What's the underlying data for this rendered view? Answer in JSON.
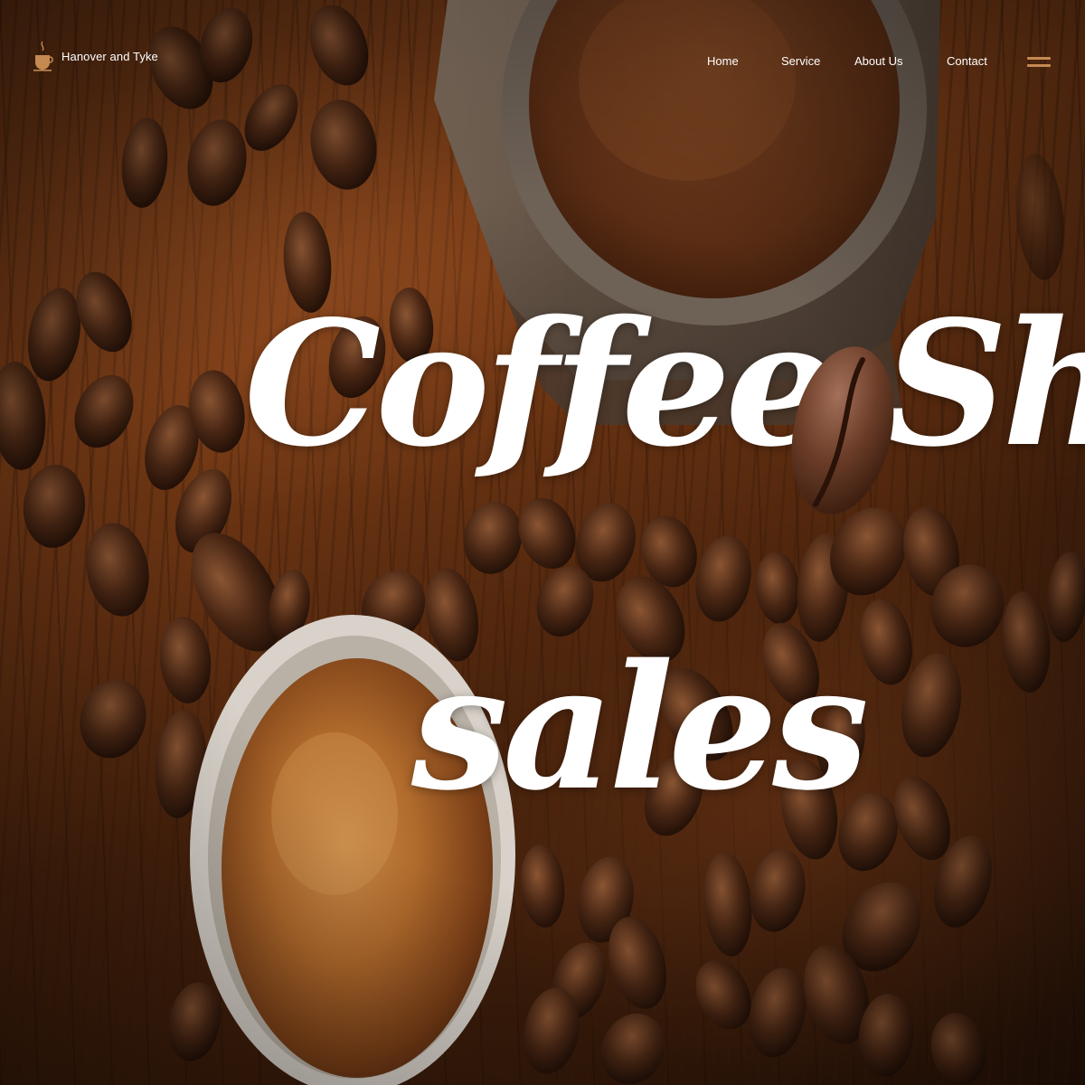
{
  "brand": {
    "name": "Hanover and Tyke",
    "icon": "coffee-cup-icon"
  },
  "nav": {
    "items": [
      {
        "label": "Home"
      },
      {
        "label": "Service"
      },
      {
        "label": "About Us"
      },
      {
        "label": "Contact"
      }
    ],
    "menu_icon": "hamburger-menu-icon"
  },
  "hero": {
    "headline_line1": "Coffee Shop",
    "headline_line2": "sales",
    "background": "coffee beans, grinder and espresso cup photo"
  },
  "colors": {
    "accent": "#c58a52",
    "text": "#ffffff"
  }
}
